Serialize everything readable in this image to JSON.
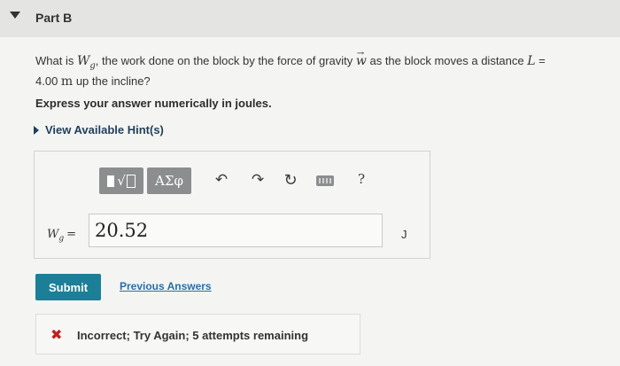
{
  "header": {
    "title": "Part B"
  },
  "question": {
    "prefix": "What is ",
    "var_main": "W",
    "var_sub": "g",
    "middle": ", the work done on the block by the force of gravity ",
    "vector_symbol": "w",
    "mid2": " as the block moves a distance ",
    "distance_var": "L",
    "equals": " =",
    "line2_value": "4.00 ",
    "line2_unit": "m",
    "line2_rest": " up the incline?"
  },
  "instruction": "Express your answer numerically in joules.",
  "hints": {
    "label": "View Available Hint(s)"
  },
  "toolbar": {
    "greek_label": "ΑΣφ",
    "radical_symbol": "√",
    "undo_icon": "undo-icon",
    "redo_icon": "redo-icon",
    "reset_icon": "reset-icon",
    "keyboard_icon": "keyboard-icon",
    "help_label": "?"
  },
  "answer": {
    "label_main": "W",
    "label_sub": "g",
    "label_eq": "=",
    "value": "20.52",
    "unit": "J"
  },
  "actions": {
    "submit_label": "Submit",
    "previous_answers_label": "Previous Answers"
  },
  "feedback": {
    "icon": "x-icon",
    "text": "Incorrect; Try Again; 5 attempts remaining",
    "color": "#c0201e"
  },
  "colors": {
    "submit_bg": "#1b7f97",
    "link": "#2a6ea7",
    "toolbar_btn": "#8b8d8f"
  }
}
